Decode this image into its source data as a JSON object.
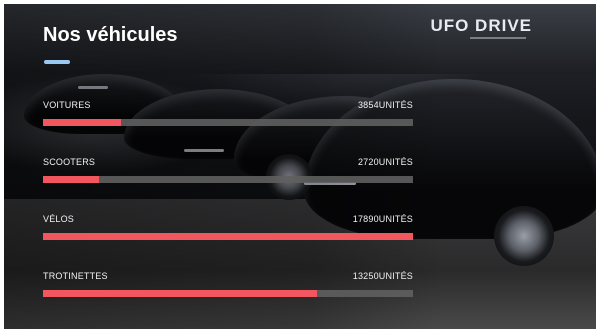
{
  "brand": "UFO DRIVE",
  "title": "Nos véhicules",
  "colors": {
    "accent_underline": "#9bc8f0",
    "bar_fill": "#f2565f",
    "bar_track": "#5f5f5f"
  },
  "stats": [
    {
      "label": "VOITURES",
      "value": "3854UNITÉS",
      "fill_fraction": 0.21
    },
    {
      "label": "SCOOTERS",
      "value": "2720UNITÉS",
      "fill_fraction": 0.15
    },
    {
      "label": "VÉLOS",
      "value": "17890UNITÉS",
      "fill_fraction": 1.0
    },
    {
      "label": "TROTINETTES",
      "value": "13250UNITÉS",
      "fill_fraction": 0.74
    }
  ]
}
